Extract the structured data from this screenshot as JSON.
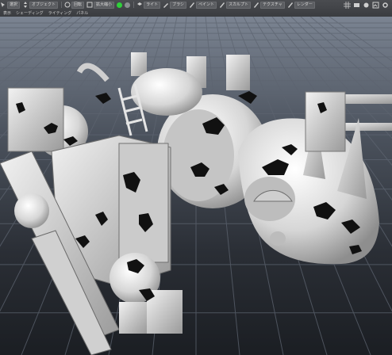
{
  "toolbar": {
    "row1": [
      {
        "icon": "select-tool-icon",
        "label": "選択"
      },
      {
        "icon": "move-tool-icon",
        "label": "オブジェクト"
      },
      {
        "icon": "rotate-tool-icon",
        "label": "回転"
      },
      {
        "icon": "scale-tool-icon",
        "label": "拡大縮小"
      },
      {
        "icon": "record-icon",
        "label": ""
      },
      {
        "icon": "layer-icon",
        "label": "ライト"
      },
      {
        "icon": "brush-icon",
        "label": "ブラシ"
      },
      {
        "icon": "pen-icon",
        "label": "ペイント"
      },
      {
        "icon": "pen-icon",
        "label": "スカルプト"
      },
      {
        "icon": "pen-icon",
        "label": "テクスチャ"
      },
      {
        "icon": "pen-icon",
        "label": "レンダー"
      }
    ],
    "right_icons": [
      "grid-icon",
      "camera-icon",
      "light-icon",
      "render-icon",
      "settings-icon"
    ],
    "row2": [
      {
        "icon": "",
        "label": "表示"
      },
      {
        "icon": "",
        "label": "シェーディング"
      },
      {
        "icon": "",
        "label": "ライティング"
      },
      {
        "icon": "",
        "label": "パネル"
      }
    ]
  },
  "colors": {
    "toolbar_bg": "#3f4145",
    "status_green": "#2fd03a",
    "grid_line": "#5d6470",
    "model_body": "#d9d9d9",
    "model_dark": "#111111"
  },
  "viewport": {
    "model": "mech-robot-3d-model",
    "grid": true
  }
}
